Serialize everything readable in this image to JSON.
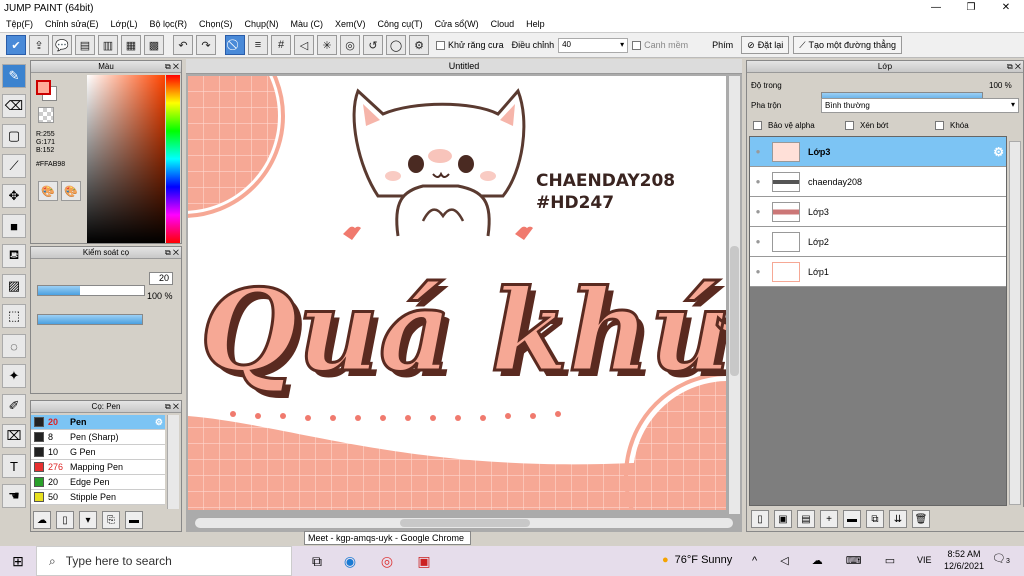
{
  "window": {
    "title": "JUMP PAINT (64bit)",
    "min": "—",
    "max": "❐",
    "close": "✕"
  },
  "menu": [
    "Tệp(F)",
    "Chỉnh sửa(E)",
    "Lớp(L)",
    "Bộ lọc(R)",
    "Chọn(S)",
    "Chụp(N)",
    "Màu (C)",
    "Xem(V)",
    "Công cụ(T)",
    "Cửa sổ(W)",
    "Cloud",
    "Help"
  ],
  "toolbar": {
    "antialias_label": "Khử răng cưa",
    "adjust_label": "Điều chỉnh",
    "adjust_value": "40",
    "snap_label": "Canh mềm",
    "key_label": "Phím",
    "reset_label": "Đặt lại",
    "newline_label": "Tạo một đường thẳng"
  },
  "color_panel": {
    "title": "Màu",
    "r": "R:255",
    "g": "G:171",
    "b": "B:152",
    "hex": "#FFAB98",
    "fg_color": "#FFAB98"
  },
  "brush_control": {
    "title": "Kiểm soát cọ",
    "size": "20",
    "opacity": "100 %",
    "size_fill": 0.4,
    "opacity_fill": 1.0
  },
  "brush_list": {
    "title": "Cọ: Pen",
    "items": [
      {
        "size": "20",
        "name": "Pen",
        "color": "#222222"
      },
      {
        "size": "8",
        "name": "Pen (Sharp)",
        "color": "#222222"
      },
      {
        "size": "10",
        "name": "G Pen",
        "color": "#222222"
      },
      {
        "size": "276",
        "name": "Mapping Pen",
        "color": "#e83030"
      },
      {
        "size": "20",
        "name": "Edge Pen",
        "color": "#2aa02a"
      },
      {
        "size": "50",
        "name": "Stipple Pen",
        "color": "#e8e020"
      }
    ]
  },
  "canvas": {
    "tab": "Untitled",
    "text1": "CHAENDAY208",
    "text2": "#HD247",
    "headline": "Quá khứ"
  },
  "layers": {
    "title": "Lớp",
    "opacity_label": "Độ trong",
    "opacity_value": "100 %",
    "blend_label": "Pha trộn",
    "blend_value": "Bình thường",
    "protect_alpha": "Bảo vệ alpha",
    "clip": "Xén bớt",
    "lock": "Khóa",
    "items": [
      {
        "name": "Lớp3"
      },
      {
        "name": "chaenday208"
      },
      {
        "name": "Lớp3"
      },
      {
        "name": "Lớp2"
      },
      {
        "name": "Lớp1"
      }
    ]
  },
  "tooltip": "Meet - kgp-amqs-uyk - Google Chrome",
  "taskbar": {
    "search": "Type here to search",
    "weather": "76°F  Sunny",
    "lang": "VIE",
    "time": "8:52 AM",
    "date": "12/6/2021",
    "notif": "3"
  }
}
